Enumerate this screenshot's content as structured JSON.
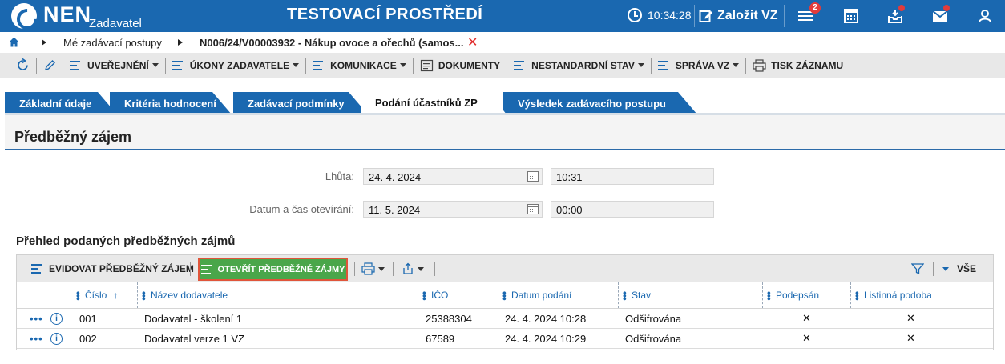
{
  "header": {
    "logo": "NEN",
    "logo_sub": "Zadavatel",
    "env_title": "TESTOVACÍ PROSTŘEDÍ",
    "clock": "10:34:28",
    "new_vz_label": "Založit VZ",
    "menu_badge": "2",
    "icons": [
      "menu-icon",
      "calculator-icon",
      "inbox-icon",
      "mail-icon",
      "user-icon"
    ],
    "accent": "#1a68b0",
    "badge_color": "#e23b3b"
  },
  "breadcrumb": {
    "items": [
      "Mé zadávací postupy",
      "N006/24/V00003932 - Nákup ovoce a ořechů (samos..."
    ]
  },
  "toolbar": {
    "items": [
      {
        "label": "UVEŘEJNĚNÍ",
        "caret": true
      },
      {
        "label": "ÚKONY ZADAVATELE",
        "caret": true
      },
      {
        "label": "KOMUNIKACE",
        "caret": true
      },
      {
        "label": "DOKUMENTY",
        "caret": false
      },
      {
        "label": "NESTANDARDNÍ STAV",
        "caret": true
      },
      {
        "label": "SPRÁVA VZ",
        "caret": true
      },
      {
        "label": "TISK ZÁZNAMU",
        "caret": false
      }
    ]
  },
  "tabs": [
    {
      "label": "Základní údaje",
      "active": false
    },
    {
      "label": "Kritéria hodnocení",
      "active": false
    },
    {
      "label": "Zadávací podmínky",
      "active": false
    },
    {
      "label": "Podání účastníků ZP",
      "active": true
    },
    {
      "label": "Výsledek zadávacího postupu",
      "active": false
    }
  ],
  "section": {
    "title": "Předběžný zájem",
    "deadline": {
      "label": "Lhůta:",
      "date": "24. 4. 2024",
      "time": "10:31"
    },
    "opening": {
      "label": "Datum a čas otevírání:",
      "date": "11. 5. 2024",
      "time": "00:00"
    }
  },
  "overview": {
    "title": "Přehled podaných předběžných zájmů",
    "toolbar": {
      "register_label": "EVIDOVAT PŘEDBĚŽNÝ ZÁJEM",
      "open_label": "OTEVŘÍT PŘEDBĚŽNÉ ZÁJMY",
      "filter_all_label": "VŠE",
      "open_button_color": "#4aa64a"
    },
    "columns": [
      "Číslo",
      "Název dodavatele",
      "IČO",
      "Datum podání",
      "Stav",
      "Podepsán",
      "Listinná podoba"
    ],
    "sort_indicator": "↑",
    "rows": [
      {
        "number": "001",
        "supplier": "Dodavatel - školení 1",
        "ico": "25388304",
        "submitted": "24. 4. 2024 10:28",
        "state": "Odšifrována",
        "signed": "✕",
        "paper": "✕"
      },
      {
        "number": "002",
        "supplier": "Dodavatel verze 1 VZ",
        "ico": "67589",
        "submitted": "24. 4. 2024 10:29",
        "state": "Odšifrována",
        "signed": "✕",
        "paper": "✕"
      }
    ]
  }
}
